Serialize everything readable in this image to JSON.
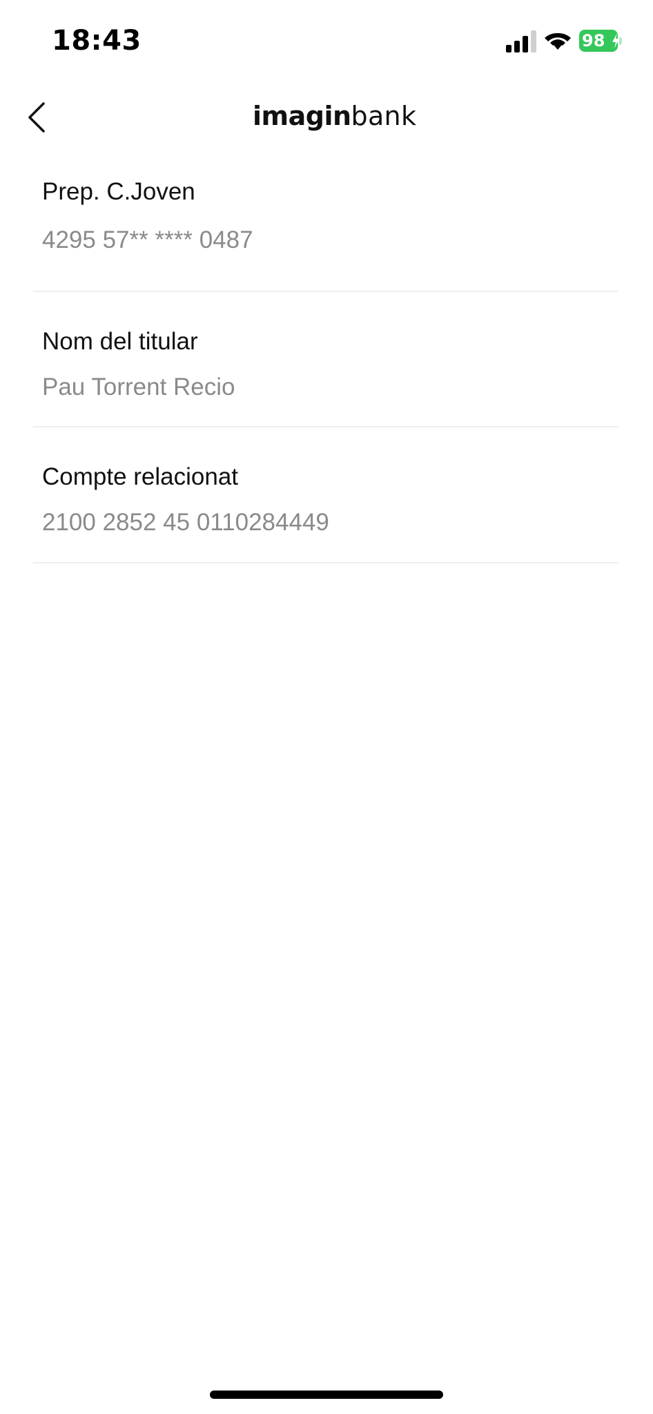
{
  "status_bar": {
    "time": "18:43",
    "battery_level": "98",
    "battery_color": "#34c759",
    "icons": [
      "signal-icon",
      "wifi-icon",
      "battery-icon",
      "charging-bolt-icon"
    ]
  },
  "header": {
    "logo_bold": "imagin",
    "logo_light": "bank",
    "back_icon": "chevron-left-icon"
  },
  "details": {
    "card": {
      "label": "Prep. C.Joven",
      "value": "4295 57** **** 0487"
    },
    "holder": {
      "label": "Nom del titular",
      "value": "Pau Torrent Recio"
    },
    "account": {
      "label": "Compte relacionat",
      "value": "2100 2852 45 0110284449"
    }
  },
  "colors": {
    "label_text": "#111111",
    "value_text": "#8a8a8a",
    "divider": "#efefef"
  }
}
